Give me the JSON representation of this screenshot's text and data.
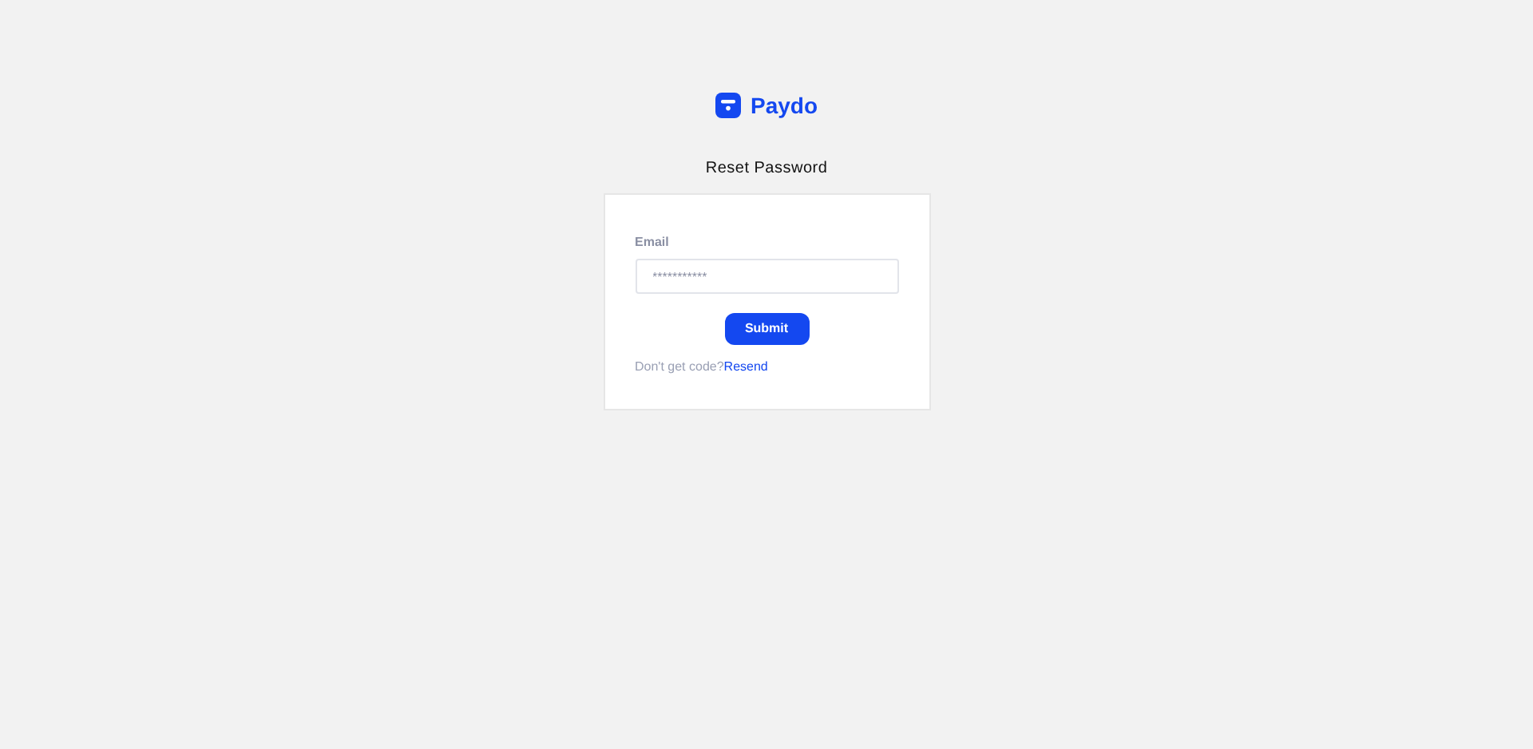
{
  "brand": {
    "name": "Paydo"
  },
  "title": "Reset Password",
  "form": {
    "email_label": "Email",
    "email_placeholder": "***********",
    "submit": "Submit",
    "footer_text": "Don't get code?",
    "footer_link": "Resend"
  }
}
